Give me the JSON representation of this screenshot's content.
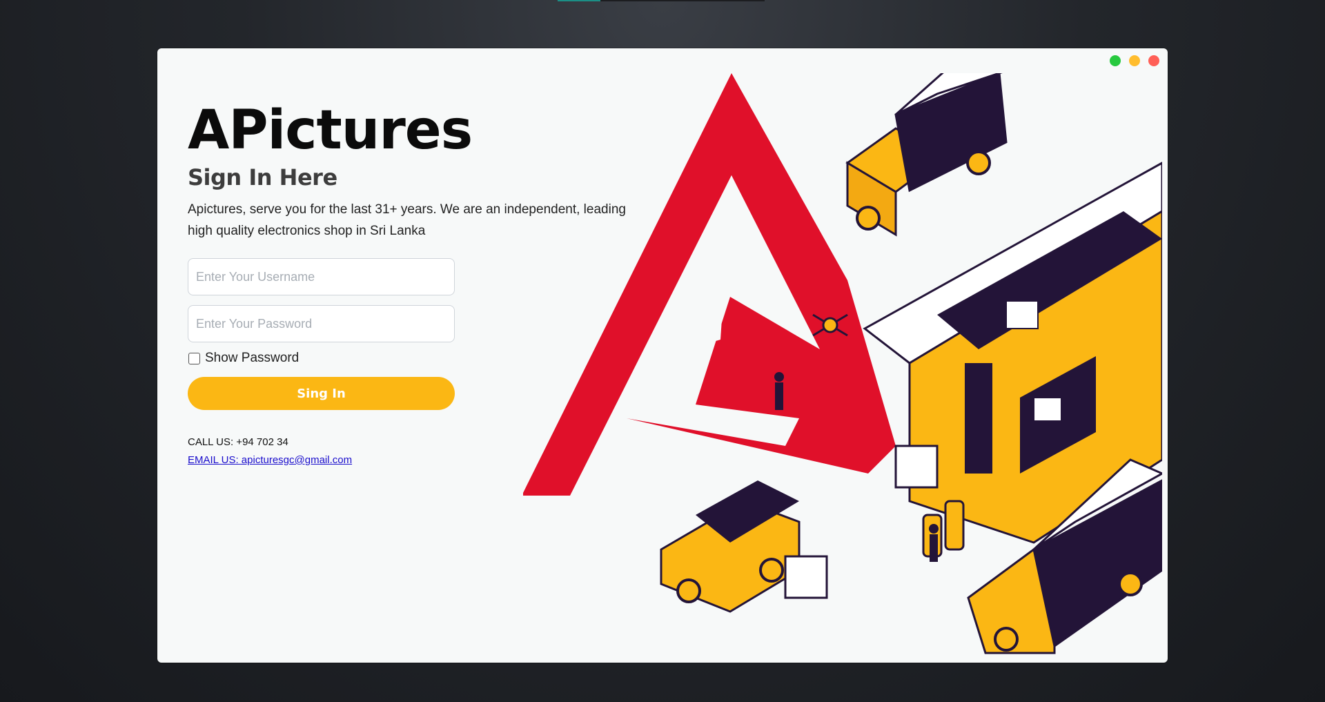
{
  "window": {
    "controls": [
      {
        "name": "green",
        "color": "#27c93f"
      },
      {
        "name": "yellow",
        "color": "#ffbd2e"
      },
      {
        "name": "red",
        "color": "#ff5f57"
      }
    ]
  },
  "brand": {
    "title": "APictures"
  },
  "form": {
    "heading": "Sign In Here",
    "description": "Apictures, serve you for the last 31+ years. We are an independent, leading high quality electronics shop in Sri Lanka",
    "username_placeholder": "Enter Your Username",
    "password_placeholder": "Enter Your Password",
    "show_password_label": "Show Password",
    "signin_label": "Sing In"
  },
  "contact": {
    "call": "CALL US: +94 702 34",
    "email": "EMAIL US: apicturesgc@gmail.com"
  },
  "colors": {
    "accent": "#fbb714",
    "logo_red": "#e0102a",
    "navy": "#231438"
  }
}
